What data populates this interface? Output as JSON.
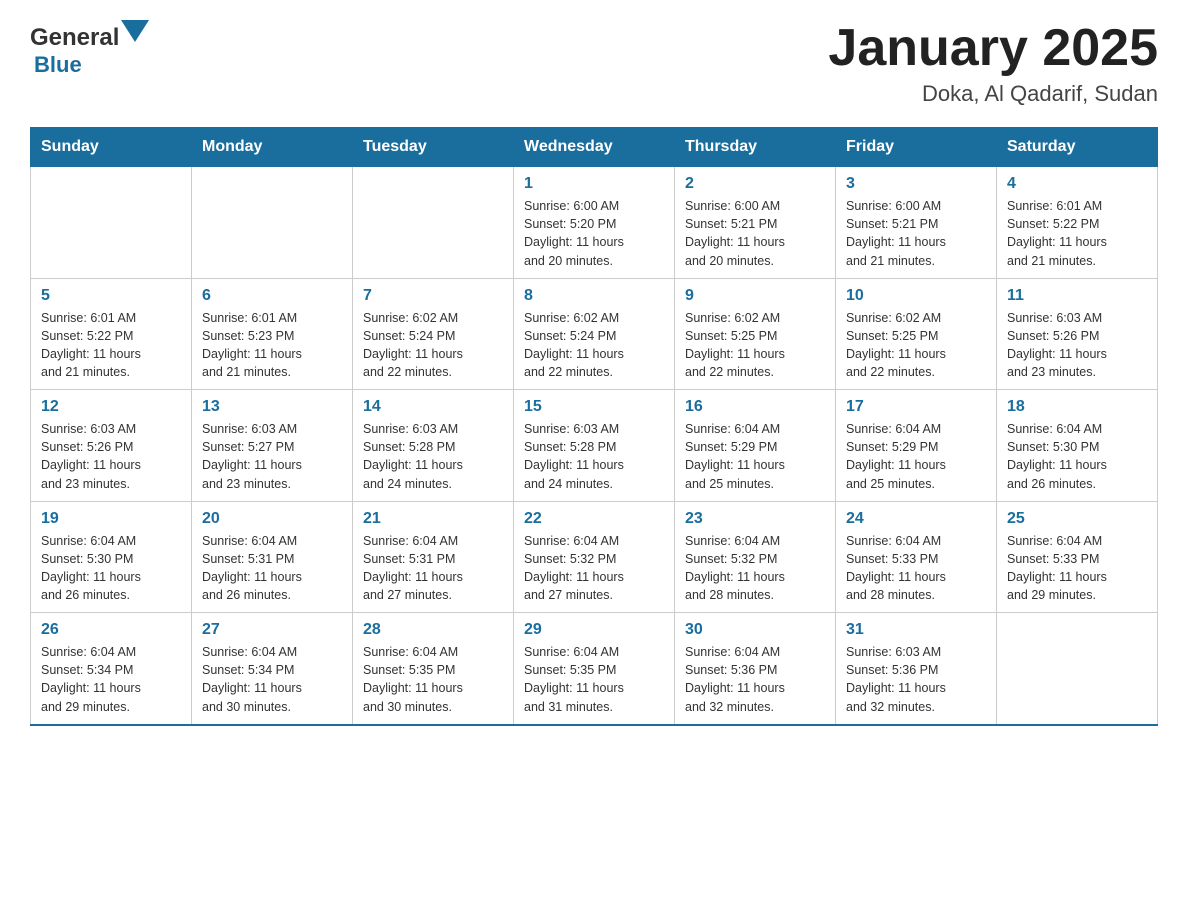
{
  "header": {
    "title": "January 2025",
    "subtitle": "Doka, Al Qadarif, Sudan",
    "logo_general": "General",
    "logo_blue": "Blue"
  },
  "calendar": {
    "days_of_week": [
      "Sunday",
      "Monday",
      "Tuesday",
      "Wednesday",
      "Thursday",
      "Friday",
      "Saturday"
    ],
    "weeks": [
      [
        {
          "day": "",
          "info": ""
        },
        {
          "day": "",
          "info": ""
        },
        {
          "day": "",
          "info": ""
        },
        {
          "day": "1",
          "info": "Sunrise: 6:00 AM\nSunset: 5:20 PM\nDaylight: 11 hours\nand 20 minutes."
        },
        {
          "day": "2",
          "info": "Sunrise: 6:00 AM\nSunset: 5:21 PM\nDaylight: 11 hours\nand 20 minutes."
        },
        {
          "day": "3",
          "info": "Sunrise: 6:00 AM\nSunset: 5:21 PM\nDaylight: 11 hours\nand 21 minutes."
        },
        {
          "day": "4",
          "info": "Sunrise: 6:01 AM\nSunset: 5:22 PM\nDaylight: 11 hours\nand 21 minutes."
        }
      ],
      [
        {
          "day": "5",
          "info": "Sunrise: 6:01 AM\nSunset: 5:22 PM\nDaylight: 11 hours\nand 21 minutes."
        },
        {
          "day": "6",
          "info": "Sunrise: 6:01 AM\nSunset: 5:23 PM\nDaylight: 11 hours\nand 21 minutes."
        },
        {
          "day": "7",
          "info": "Sunrise: 6:02 AM\nSunset: 5:24 PM\nDaylight: 11 hours\nand 22 minutes."
        },
        {
          "day": "8",
          "info": "Sunrise: 6:02 AM\nSunset: 5:24 PM\nDaylight: 11 hours\nand 22 minutes."
        },
        {
          "day": "9",
          "info": "Sunrise: 6:02 AM\nSunset: 5:25 PM\nDaylight: 11 hours\nand 22 minutes."
        },
        {
          "day": "10",
          "info": "Sunrise: 6:02 AM\nSunset: 5:25 PM\nDaylight: 11 hours\nand 22 minutes."
        },
        {
          "day": "11",
          "info": "Sunrise: 6:03 AM\nSunset: 5:26 PM\nDaylight: 11 hours\nand 23 minutes."
        }
      ],
      [
        {
          "day": "12",
          "info": "Sunrise: 6:03 AM\nSunset: 5:26 PM\nDaylight: 11 hours\nand 23 minutes."
        },
        {
          "day": "13",
          "info": "Sunrise: 6:03 AM\nSunset: 5:27 PM\nDaylight: 11 hours\nand 23 minutes."
        },
        {
          "day": "14",
          "info": "Sunrise: 6:03 AM\nSunset: 5:28 PM\nDaylight: 11 hours\nand 24 minutes."
        },
        {
          "day": "15",
          "info": "Sunrise: 6:03 AM\nSunset: 5:28 PM\nDaylight: 11 hours\nand 24 minutes."
        },
        {
          "day": "16",
          "info": "Sunrise: 6:04 AM\nSunset: 5:29 PM\nDaylight: 11 hours\nand 25 minutes."
        },
        {
          "day": "17",
          "info": "Sunrise: 6:04 AM\nSunset: 5:29 PM\nDaylight: 11 hours\nand 25 minutes."
        },
        {
          "day": "18",
          "info": "Sunrise: 6:04 AM\nSunset: 5:30 PM\nDaylight: 11 hours\nand 26 minutes."
        }
      ],
      [
        {
          "day": "19",
          "info": "Sunrise: 6:04 AM\nSunset: 5:30 PM\nDaylight: 11 hours\nand 26 minutes."
        },
        {
          "day": "20",
          "info": "Sunrise: 6:04 AM\nSunset: 5:31 PM\nDaylight: 11 hours\nand 26 minutes."
        },
        {
          "day": "21",
          "info": "Sunrise: 6:04 AM\nSunset: 5:31 PM\nDaylight: 11 hours\nand 27 minutes."
        },
        {
          "day": "22",
          "info": "Sunrise: 6:04 AM\nSunset: 5:32 PM\nDaylight: 11 hours\nand 27 minutes."
        },
        {
          "day": "23",
          "info": "Sunrise: 6:04 AM\nSunset: 5:32 PM\nDaylight: 11 hours\nand 28 minutes."
        },
        {
          "day": "24",
          "info": "Sunrise: 6:04 AM\nSunset: 5:33 PM\nDaylight: 11 hours\nand 28 minutes."
        },
        {
          "day": "25",
          "info": "Sunrise: 6:04 AM\nSunset: 5:33 PM\nDaylight: 11 hours\nand 29 minutes."
        }
      ],
      [
        {
          "day": "26",
          "info": "Sunrise: 6:04 AM\nSunset: 5:34 PM\nDaylight: 11 hours\nand 29 minutes."
        },
        {
          "day": "27",
          "info": "Sunrise: 6:04 AM\nSunset: 5:34 PM\nDaylight: 11 hours\nand 30 minutes."
        },
        {
          "day": "28",
          "info": "Sunrise: 6:04 AM\nSunset: 5:35 PM\nDaylight: 11 hours\nand 30 minutes."
        },
        {
          "day": "29",
          "info": "Sunrise: 6:04 AM\nSunset: 5:35 PM\nDaylight: 11 hours\nand 31 minutes."
        },
        {
          "day": "30",
          "info": "Sunrise: 6:04 AM\nSunset: 5:36 PM\nDaylight: 11 hours\nand 32 minutes."
        },
        {
          "day": "31",
          "info": "Sunrise: 6:03 AM\nSunset: 5:36 PM\nDaylight: 11 hours\nand 32 minutes."
        },
        {
          "day": "",
          "info": ""
        }
      ]
    ]
  }
}
